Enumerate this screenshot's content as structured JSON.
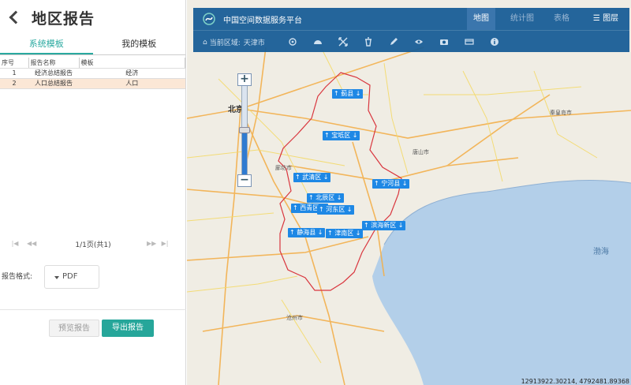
{
  "header": {
    "title": "地区报告"
  },
  "tabs": [
    {
      "label": "系统模板",
      "active": true
    },
    {
      "label": "我的模板",
      "active": false
    }
  ],
  "table": {
    "columns": [
      "序号",
      "报告名称",
      "模板"
    ],
    "rows": [
      {
        "no": "1",
        "name": "经济总结报告",
        "template": "经济"
      },
      {
        "no": "2",
        "name": "人口总结报告",
        "template": "人口"
      }
    ]
  },
  "pager": {
    "info": "1/1页(共1)"
  },
  "format": {
    "label": "报告格式:",
    "value": "PDF"
  },
  "actions": {
    "preview": "预览报告",
    "export": "导出报告"
  },
  "map": {
    "app_title": "中国空间数据服务平台",
    "nav": {
      "map": "地图",
      "stat": "统计图",
      "table": "表格",
      "layer": "图层"
    },
    "current_region_label": "当前区域:",
    "current_region": "天津市",
    "coords": "12913922.30214, 4792481.89368",
    "cities": {
      "beijing": "北京",
      "langfang": "廊坊市",
      "tangshan": "唐山市",
      "cangzhou": "沧州市",
      "qinhuangdao": "秦皇岛市",
      "bohai": "渤海"
    },
    "districts": {
      "jizhou": "蓟县",
      "baodi": "宝坻区",
      "wuqing": "武清区",
      "ninghe": "宁河县",
      "beichen": "北辰区",
      "xiqing": "西青区",
      "hedong": "河东区",
      "binhai": "滨海新区",
      "jinghai": "静海县",
      "jinnan": "津南区"
    },
    "accent": "#26a69a",
    "toolbar_color": "#165c96",
    "boundary_color": "#d9363e"
  }
}
